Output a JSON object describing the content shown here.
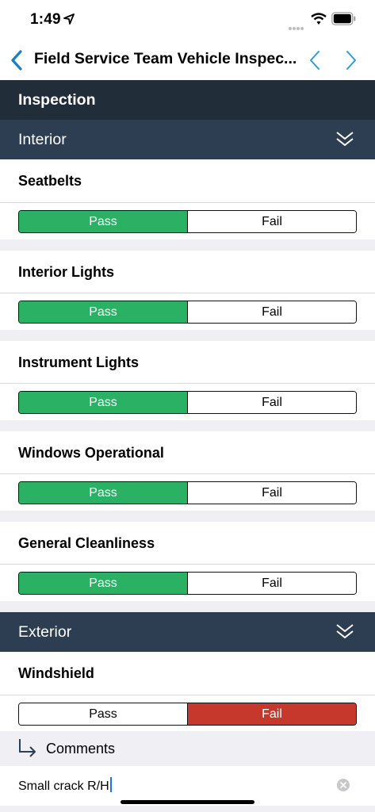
{
  "status_bar": {
    "time": "1:49"
  },
  "nav": {
    "title": "Field Service Team Vehicle Inspec..."
  },
  "section": {
    "title": "Inspection"
  },
  "groups": [
    {
      "label": "Interior",
      "items": [
        {
          "label": "Seatbelts",
          "pass": "Pass",
          "fail": "Fail",
          "selected": "Pass"
        },
        {
          "label": "Interior Lights",
          "pass": "Pass",
          "fail": "Fail",
          "selected": "Pass"
        },
        {
          "label": "Instrument Lights",
          "pass": "Pass",
          "fail": "Fail",
          "selected": "Pass"
        },
        {
          "label": "Windows Operational",
          "pass": "Pass",
          "fail": "Fail",
          "selected": "Pass"
        },
        {
          "label": "General Cleanliness",
          "pass": "Pass",
          "fail": "Fail",
          "selected": "Pass"
        }
      ]
    },
    {
      "label": "Exterior",
      "items": [
        {
          "label": "Windshield",
          "pass": "Pass",
          "fail": "Fail",
          "selected": "Fail"
        }
      ]
    }
  ],
  "comments": {
    "label": "Comments",
    "value": "Small crack R/H"
  },
  "colors": {
    "pass": "#2ab163",
    "fail": "#c6382c",
    "accent": "#1a7fc1",
    "header": "#222d3a",
    "group": "#2d3e52"
  }
}
